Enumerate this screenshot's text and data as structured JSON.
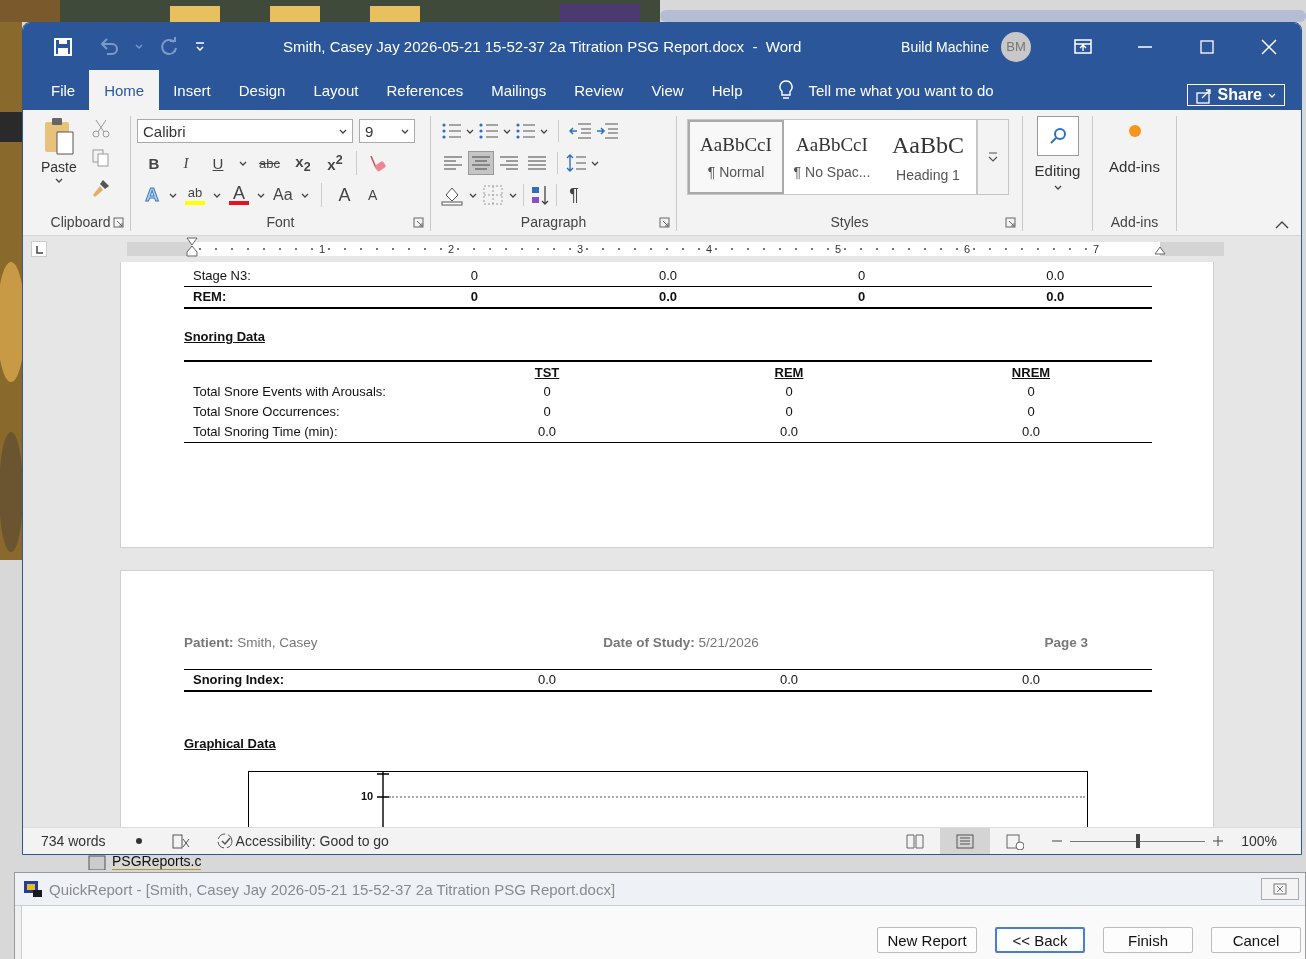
{
  "word": {
    "title": "Smith, Casey Jay 2026-05-21 15-52-37 2a Titration PSG Report.docx  -  Word",
    "user": "Build Machine",
    "avatar": "BM",
    "tabs": [
      {
        "label": "File",
        "selected": false
      },
      {
        "label": "Home",
        "selected": true
      },
      {
        "label": "Insert",
        "selected": false
      },
      {
        "label": "Design",
        "selected": false
      },
      {
        "label": "Layout",
        "selected": false
      },
      {
        "label": "References",
        "selected": false
      },
      {
        "label": "Mailings",
        "selected": false
      },
      {
        "label": "Review",
        "selected": false
      },
      {
        "label": "View",
        "selected": false
      },
      {
        "label": "Help",
        "selected": false
      }
    ],
    "tell_me": "Tell me what you want to do",
    "share": "Share",
    "ribbon": {
      "clipboard": {
        "paste": "Paste",
        "label": "Clipboard"
      },
      "font": {
        "name": "Calibri",
        "size": "9",
        "label": "Font",
        "format_buttons": [
          {
            "kind": "bold",
            "label": "B"
          },
          {
            "kind": "italic",
            "label": "I"
          },
          {
            "kind": "underline",
            "label": "U"
          },
          {
            "kind": "strike",
            "label": "abc"
          },
          {
            "kind": "sub",
            "label": "x$_{2}$"
          },
          {
            "kind": "sup",
            "label": "x$^{2}$"
          }
        ],
        "color_buttons": [
          {
            "kind": "effects",
            "label": "A"
          },
          {
            "kind": "highlight",
            "label": "ab",
            "color": "#ffff00"
          },
          {
            "kind": "color",
            "label": "A",
            "color": "#e81123"
          },
          {
            "kind": "case",
            "label": "Aa"
          },
          {
            "kind": "grow",
            "label": "A"
          },
          {
            "kind": "shrink",
            "label": "A"
          }
        ]
      },
      "paragraph": {
        "label": "Paragraph",
        "pilcrow": "¶",
        "alignments": [
          {
            "kind": "left",
            "selected": false
          },
          {
            "kind": "center",
            "selected": true
          },
          {
            "kind": "right",
            "selected": false
          },
          {
            "kind": "justify",
            "selected": false
          }
        ]
      },
      "styles": {
        "label": "Styles",
        "items": [
          {
            "sample": "AaBbCcI",
            "name": "¶ Normal",
            "kind": "body",
            "selected": true
          },
          {
            "sample": "AaBbCcI",
            "name": "¶ No Spac...",
            "kind": "body",
            "selected": false
          },
          {
            "sample": "AaBbC",
            "name": "Heading 1",
            "kind": "heading",
            "selected": false
          }
        ]
      },
      "editing": "Editing",
      "addins": {
        "button": "Add-ins",
        "label": "Add-ins"
      }
    },
    "ruler": [
      "1",
      "2",
      "3",
      "4",
      "5",
      "6",
      "7"
    ],
    "document": {
      "stage_rows": [
        {
          "cells": [
            "Stage N3:",
            "0",
            "0.0",
            "0",
            "0.0"
          ],
          "bold": false
        },
        {
          "cells": [
            "REM:",
            "0",
            "0.0",
            "0",
            "0.0"
          ],
          "bold": true
        }
      ],
      "snoring_heading": "Snoring Data",
      "snoring_columns": [
        "TST",
        "REM",
        "NREM"
      ],
      "snoring_rows": [
        [
          "Total Snore Events with Arousals:",
          "0",
          "0",
          "0"
        ],
        [
          "Total Snore Occurrences:",
          "0",
          "0",
          "0"
        ],
        [
          "Total Snoring Time (min):",
          "0.0",
          "0.0",
          "0.0"
        ]
      ],
      "page_header": {
        "patient": "**Patient:** Smith, Casey",
        "date": "**Date of Study:** 5/21/2026",
        "page": "Page 3"
      },
      "index_row": [
        "Snoring Index:",
        "0.0",
        "0.0",
        "0.0"
      ],
      "graph_heading": "Graphical Data",
      "graph_tick": "10"
    },
    "status_bar": {
      "words": "734 words",
      "accessibility": "Accessibility: Good to go",
      "zoom": "100%",
      "zoom_slider": {
        "level": 0.5
      },
      "views": [
        {
          "kind": "read",
          "selected": false
        },
        {
          "kind": "print",
          "selected": true
        },
        {
          "kind": "web",
          "selected": false
        }
      ]
    }
  },
  "background_file": "PSGReports.c",
  "quickreport": {
    "title": "QuickReport - [Smith, Casey Jay 2026-05-21 15-52-37 2a Titration PSG Report.docx]",
    "buttons": [
      {
        "label": "New Report",
        "focused": false
      },
      {
        "label": "<< Back",
        "focused": true
      },
      {
        "label": "Finish",
        "focused": false
      },
      {
        "label": "Cancel",
        "focused": false
      }
    ]
  }
}
